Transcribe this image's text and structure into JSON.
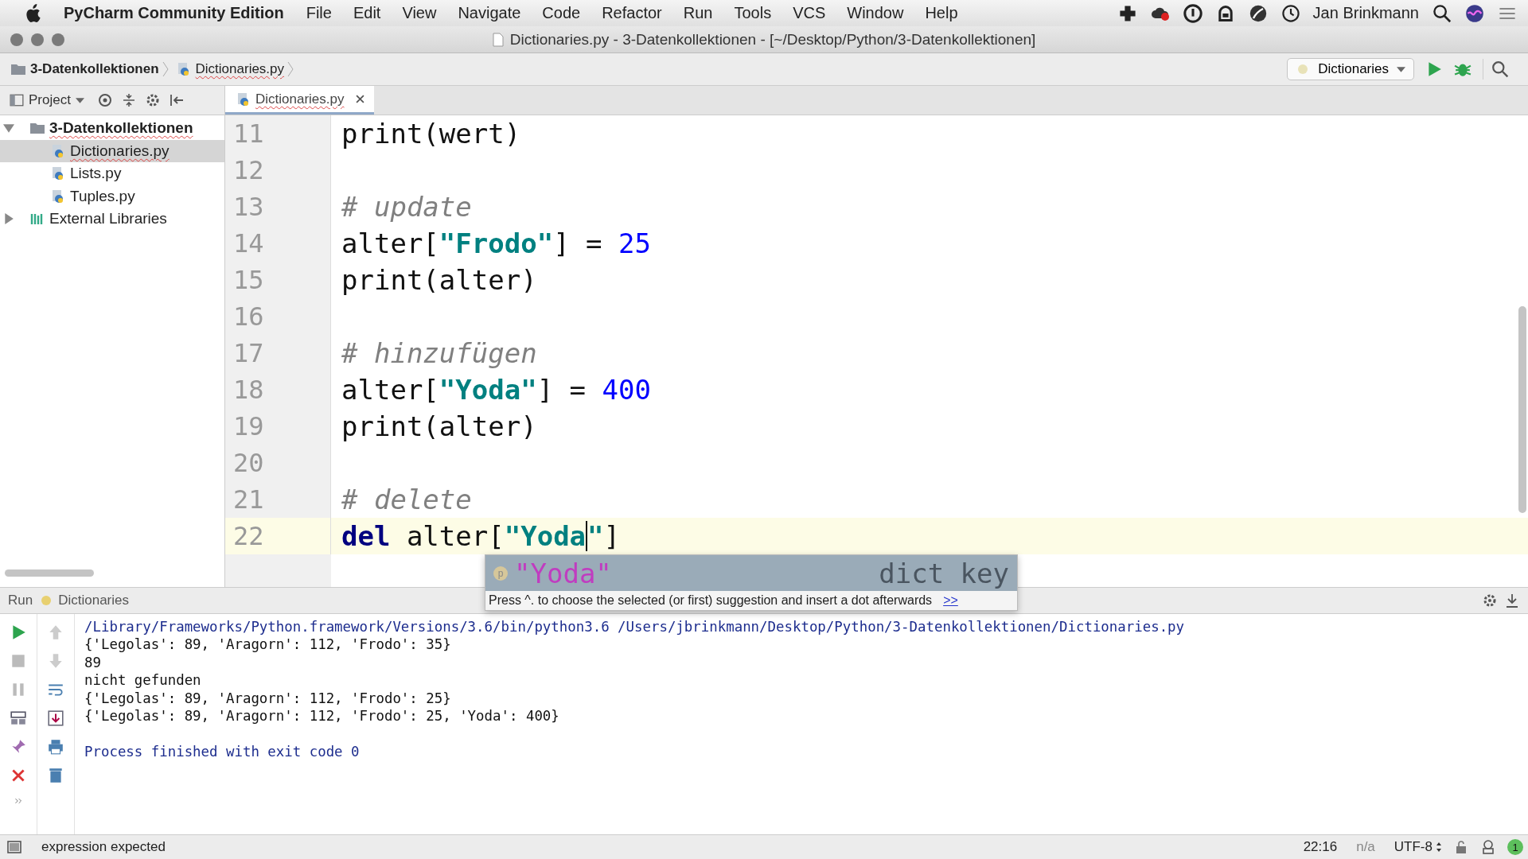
{
  "menu_bar": {
    "app_name": "PyCharm Community Edition",
    "menus": [
      "File",
      "Edit",
      "View",
      "Navigate",
      "Code",
      "Refactor",
      "Run",
      "Tools",
      "VCS",
      "Window",
      "Help"
    ],
    "user": "Jan Brinkmann"
  },
  "window": {
    "title": "Dictionaries.py - 3-Datenkollektionen - [~/Desktop/Python/3-Datenkollektionen]"
  },
  "breadcrumbs": [
    "3-Datenkollektionen",
    "Dictionaries.py"
  ],
  "run_config": {
    "label": "Dictionaries"
  },
  "project_panel": {
    "label": "Project",
    "tree": [
      {
        "label": "3-Datenkollektionen",
        "kind": "folder",
        "expanded": true,
        "selected": false,
        "children": [
          {
            "label": "Dictionaries.py",
            "kind": "file",
            "selected": true
          },
          {
            "label": "Lists.py",
            "kind": "file",
            "selected": false
          },
          {
            "label": "Tuples.py",
            "kind": "file",
            "selected": false
          }
        ]
      },
      {
        "label": "External Libraries",
        "kind": "library",
        "expanded": false,
        "selected": false
      }
    ]
  },
  "tabs": [
    {
      "label": "Dictionaries.py",
      "selected": true
    }
  ],
  "editor": {
    "lines": [
      {
        "number": "11",
        "current": false,
        "tokens": [
          {
            "kind": "plain",
            "text": "print(wert)"
          }
        ]
      },
      {
        "number": "12",
        "current": false
      },
      {
        "number": "13",
        "current": false,
        "tokens": [
          {
            "kind": "comment",
            "text": "# update"
          }
        ]
      },
      {
        "number": "14",
        "current": false,
        "tokens": [
          {
            "kind": "plain",
            "text": "alter["
          },
          {
            "kind": "string",
            "text": "\"Frodo\""
          },
          {
            "kind": "plain",
            "text": "] = "
          },
          {
            "kind": "number",
            "text": "25"
          }
        ]
      },
      {
        "number": "15",
        "current": false,
        "tokens": [
          {
            "kind": "plain",
            "text": "print(alter)"
          }
        ]
      },
      {
        "number": "16",
        "current": false
      },
      {
        "number": "17",
        "current": false,
        "tokens": [
          {
            "kind": "comment",
            "text": "# hinzufügen"
          }
        ]
      },
      {
        "number": "18",
        "current": false,
        "tokens": [
          {
            "kind": "plain",
            "text": "alter["
          },
          {
            "kind": "string",
            "text": "\"Yoda\""
          },
          {
            "kind": "plain",
            "text": "] = "
          },
          {
            "kind": "number",
            "text": "400"
          }
        ]
      },
      {
        "number": "19",
        "current": false,
        "tokens": [
          {
            "kind": "plain",
            "text": "print(alter)"
          }
        ]
      },
      {
        "number": "20",
        "current": false
      },
      {
        "number": "21",
        "current": false,
        "tokens": [
          {
            "kind": "comment",
            "text": "# delete"
          }
        ]
      },
      {
        "number": "22",
        "current": true,
        "tokens": [
          {
            "kind": "keyword",
            "text": "del"
          },
          {
            "kind": "plain",
            "text": " alter["
          },
          {
            "kind": "string",
            "text": "\"Yoda"
          },
          {
            "kind": "caret"
          },
          {
            "kind": "string",
            "text": "\""
          },
          {
            "kind": "plain",
            "text": "]"
          }
        ]
      }
    ]
  },
  "completion": {
    "items": [
      {
        "badge": "p",
        "text": "\"Yoda\"",
        "type": "dict key",
        "selected": true
      }
    ],
    "hint": "Press ^. to choose the selected (or first) suggestion and insert a dot afterwards",
    "hint_link": ">>"
  },
  "run_panel": {
    "label": "Run",
    "tab": "Dictionaries",
    "output": [
      {
        "kind": "command",
        "text": "/Library/Frameworks/Python.framework/Versions/3.6/bin/python3.6 /Users/jbrinkmann/Desktop/Python/3-Datenkollektionen/Dictionaries.py"
      },
      {
        "kind": "output",
        "text": "{'Legolas': 89, 'Aragorn': 112, 'Frodo': 35}"
      },
      {
        "kind": "output",
        "text": "89"
      },
      {
        "kind": "output",
        "text": "nicht gefunden"
      },
      {
        "kind": "output",
        "text": "{'Legolas': 89, 'Aragorn': 112, 'Frodo': 25}"
      },
      {
        "kind": "output",
        "text": "{'Legolas': 89, 'Aragorn': 112, 'Frodo': 25, 'Yoda': 400}"
      },
      {
        "kind": "blank"
      },
      {
        "kind": "exit",
        "text": "Process finished with exit code 0"
      }
    ]
  },
  "status_bar": {
    "message": "expression expected",
    "position": "22:16",
    "line_separator": "n/a",
    "encoding": "UTF-8",
    "notifications": "1"
  }
}
